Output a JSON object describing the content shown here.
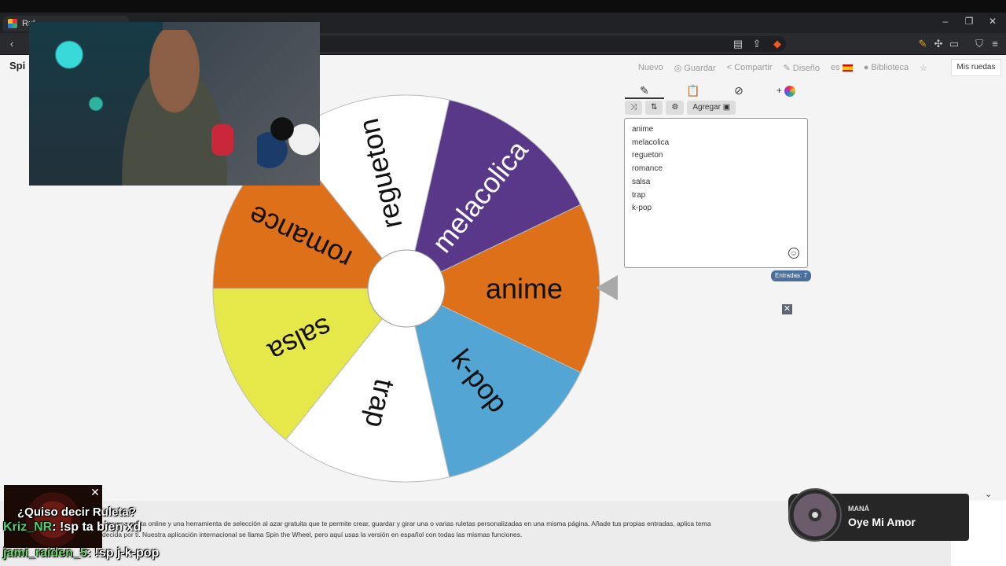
{
  "browser": {
    "tab_title": "Rul",
    "window_controls": [
      "–",
      "❐",
      "✕"
    ]
  },
  "site": {
    "logo": "Spi",
    "nav": {
      "nuevo": "Nuevo",
      "guardar": "Guardar",
      "compartir": "Compartir",
      "diseno": "Diseño",
      "lang": "es",
      "biblioteca": "Biblioteca",
      "mis_ruedas": "Mis ruedas"
    }
  },
  "wheel": {
    "segments": [
      {
        "label": "anime",
        "color": "#dd7018"
      },
      {
        "label": "k-pop",
        "color": "#53a5d3"
      },
      {
        "label": "trap",
        "color": "#ffffff"
      },
      {
        "label": "salsa",
        "color": "#e6e84a"
      },
      {
        "label": "romance",
        "color": "#dd7018"
      },
      {
        "label": "regueton",
        "color": "#ffffff"
      },
      {
        "label": "melacolica",
        "color": "#59388a"
      }
    ]
  },
  "editor": {
    "add_label": "Agregar",
    "entries": [
      "anime",
      "melacolica",
      "regueton",
      "romance",
      "salsa",
      "trap",
      "k-pop"
    ],
    "count_label": "Entradas: 7"
  },
  "footer": {
    "description_1": "...es una ruleta online y una herramienta de selección al azar gratuita que te permite crear, guardar y girar una o varias ruletas personalizadas en una misma página. Añade tus propias entradas, aplica tema",
    "description_2": "decida por ti. Nuestra aplicación internacional se llama Spin the Wheel, pero aquí usas la versión en español con todas las mismas funciones."
  },
  "chat": {
    "line1": "¿Quiso decir Ruleta?",
    "line2_name": "Kriz_NR",
    "line2_text": ": !sp ta bien xd",
    "line3_name": "jami_raiden_5",
    "line3_text": ": !sp j-k-pop"
  },
  "music": {
    "artist": "MANÁ",
    "title": "Oye Mi Amor"
  }
}
